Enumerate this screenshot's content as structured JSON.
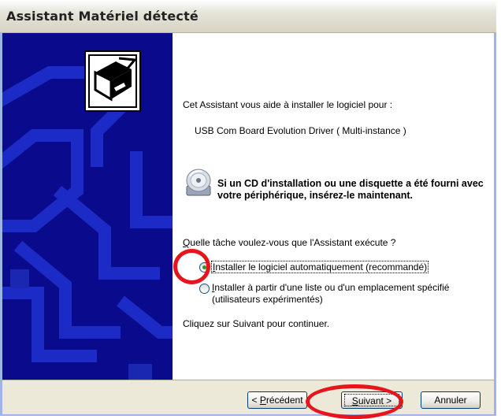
{
  "window": {
    "title": "Assistant Matériel détecté"
  },
  "content": {
    "intro": "Cet Assistant vous aide à installer le logiciel pour :",
    "device_name": "USB Com Board Evolution Driver ( Multi-instance )",
    "cd_message": "Si un CD d'installation ou une disquette a été fourni avec votre périphérique, insérez-le maintenant.",
    "question_prefix": "Q",
    "question_rest": "uelle tâche voulez-vous que l'Assistant exécute ?",
    "option1_prefix": "I",
    "option1_rest": "nstaller le logiciel automatiquement (recommandé)",
    "option1_selected": true,
    "option2_prefix": "I",
    "option2_rest": "nstaller à partir d'une liste ou d'un emplacement spécifié (utilisateurs expérimentés)",
    "option2_selected": false,
    "continue_text": "Cliquez sur Suivant pour continuer."
  },
  "buttons": {
    "prev_lt": "< ",
    "prev_ul": "P",
    "prev_rest": "récédent",
    "next_ul": "S",
    "next_rest": "uivant >",
    "cancel": "Annuler"
  },
  "icons": {
    "hardware": "hardware-wizard-icon",
    "cd": "cd-disk-icon"
  },
  "colors": {
    "panel_bg": "#0a0a8c",
    "annotation_red": "#e8141b",
    "radio_selected": "#21a121"
  }
}
